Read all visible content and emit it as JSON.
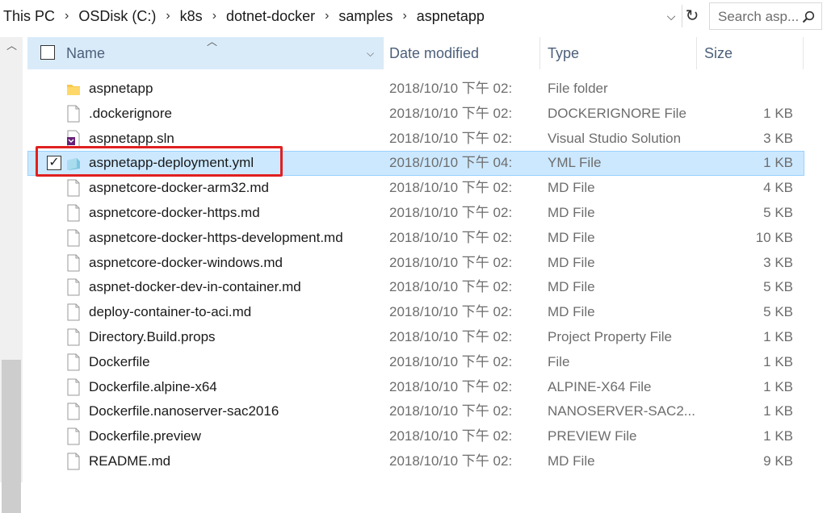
{
  "breadcrumb": [
    "This PC",
    "OSDisk (C:)",
    "k8s",
    "dotnet-docker",
    "samples",
    "aspnetapp"
  ],
  "search": {
    "placeholder": "Search asp..."
  },
  "columns": {
    "name": "Name",
    "date": "Date modified",
    "type": "Type",
    "size": "Size"
  },
  "files": [
    {
      "name": "aspnetapp",
      "date": "2018/10/10 下午 02:",
      "type": "File folder",
      "size": "",
      "icon": "folder-icon"
    },
    {
      "name": ".dockerignore",
      "date": "2018/10/10 下午 02:",
      "type": "DOCKERIGNORE File",
      "size": "1 KB",
      "icon": "file-icon"
    },
    {
      "name": "aspnetapp.sln",
      "date": "2018/10/10 下午 02:",
      "type": "Visual Studio Solution",
      "size": "3 KB",
      "icon": "vs-solution-icon"
    },
    {
      "name": "aspnetapp-deployment.yml",
      "date": "2018/10/10 下午 04:",
      "type": "YML File",
      "size": "1 KB",
      "icon": "yml-file-icon",
      "selected": true
    },
    {
      "name": "aspnetcore-docker-arm32.md",
      "date": "2018/10/10 下午 02:",
      "type": "MD File",
      "size": "4 KB",
      "icon": "file-icon"
    },
    {
      "name": "aspnetcore-docker-https.md",
      "date": "2018/10/10 下午 02:",
      "type": "MD File",
      "size": "5 KB",
      "icon": "file-icon"
    },
    {
      "name": "aspnetcore-docker-https-development.md",
      "date": "2018/10/10 下午 02:",
      "type": "MD File",
      "size": "10 KB",
      "icon": "file-icon"
    },
    {
      "name": "aspnetcore-docker-windows.md",
      "date": "2018/10/10 下午 02:",
      "type": "MD File",
      "size": "3 KB",
      "icon": "file-icon"
    },
    {
      "name": "aspnet-docker-dev-in-container.md",
      "date": "2018/10/10 下午 02:",
      "type": "MD File",
      "size": "5 KB",
      "icon": "file-icon"
    },
    {
      "name": "deploy-container-to-aci.md",
      "date": "2018/10/10 下午 02:",
      "type": "MD File",
      "size": "5 KB",
      "icon": "file-icon"
    },
    {
      "name": "Directory.Build.props",
      "date": "2018/10/10 下午 02:",
      "type": "Project Property File",
      "size": "1 KB",
      "icon": "file-icon"
    },
    {
      "name": "Dockerfile",
      "date": "2018/10/10 下午 02:",
      "type": "File",
      "size": "1 KB",
      "icon": "file-icon"
    },
    {
      "name": "Dockerfile.alpine-x64",
      "date": "2018/10/10 下午 02:",
      "type": "ALPINE-X64 File",
      "size": "1 KB",
      "icon": "file-icon"
    },
    {
      "name": "Dockerfile.nanoserver-sac2016",
      "date": "2018/10/10 下午 02:",
      "type": "NANOSERVER-SAC2...",
      "size": "1 KB",
      "icon": "file-icon"
    },
    {
      "name": "Dockerfile.preview",
      "date": "2018/10/10 下午 02:",
      "type": "PREVIEW File",
      "size": "1 KB",
      "icon": "file-icon"
    },
    {
      "name": "README.md",
      "date": "2018/10/10 下午 02:",
      "type": "MD File",
      "size": "9 KB",
      "icon": "file-icon"
    }
  ],
  "colors": {
    "selection": "#cce8ff",
    "header": "#d9ebf9",
    "highlight": "#e02020"
  }
}
